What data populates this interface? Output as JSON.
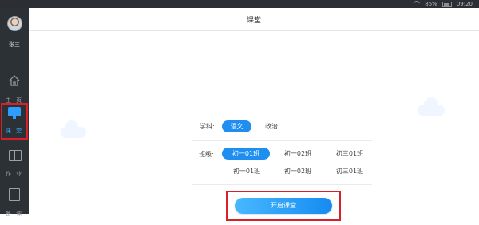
{
  "status_bar": {
    "battery": "85%",
    "time": "09:20"
  },
  "sidebar": {
    "user_name": "张三",
    "nav": [
      {
        "label": "主 页",
        "icon": "home-icon"
      },
      {
        "label": "课 堂",
        "icon": "class-icon",
        "active": true
      },
      {
        "label": "作 业",
        "icon": "book-icon"
      },
      {
        "label": "备 课",
        "icon": "prep-icon"
      }
    ]
  },
  "header": {
    "title": "课堂"
  },
  "form": {
    "subject_label": "学科:",
    "subjects": [
      {
        "label": "语文",
        "selected": true
      },
      {
        "label": "政治",
        "selected": false
      }
    ],
    "class_label": "班级:",
    "classes": [
      {
        "label": "初一01班",
        "selected": true
      },
      {
        "label": "初一02班",
        "selected": false
      },
      {
        "label": "初三01班",
        "selected": false
      },
      {
        "label": "初一01班",
        "selected": false
      },
      {
        "label": "初一02班",
        "selected": false
      },
      {
        "label": "初三01班",
        "selected": false
      }
    ],
    "start_button": "开启课堂"
  },
  "colors": {
    "accent": "#1e8ff0",
    "sidebar_bg": "#2c3136",
    "highlight": "#d9202a"
  }
}
